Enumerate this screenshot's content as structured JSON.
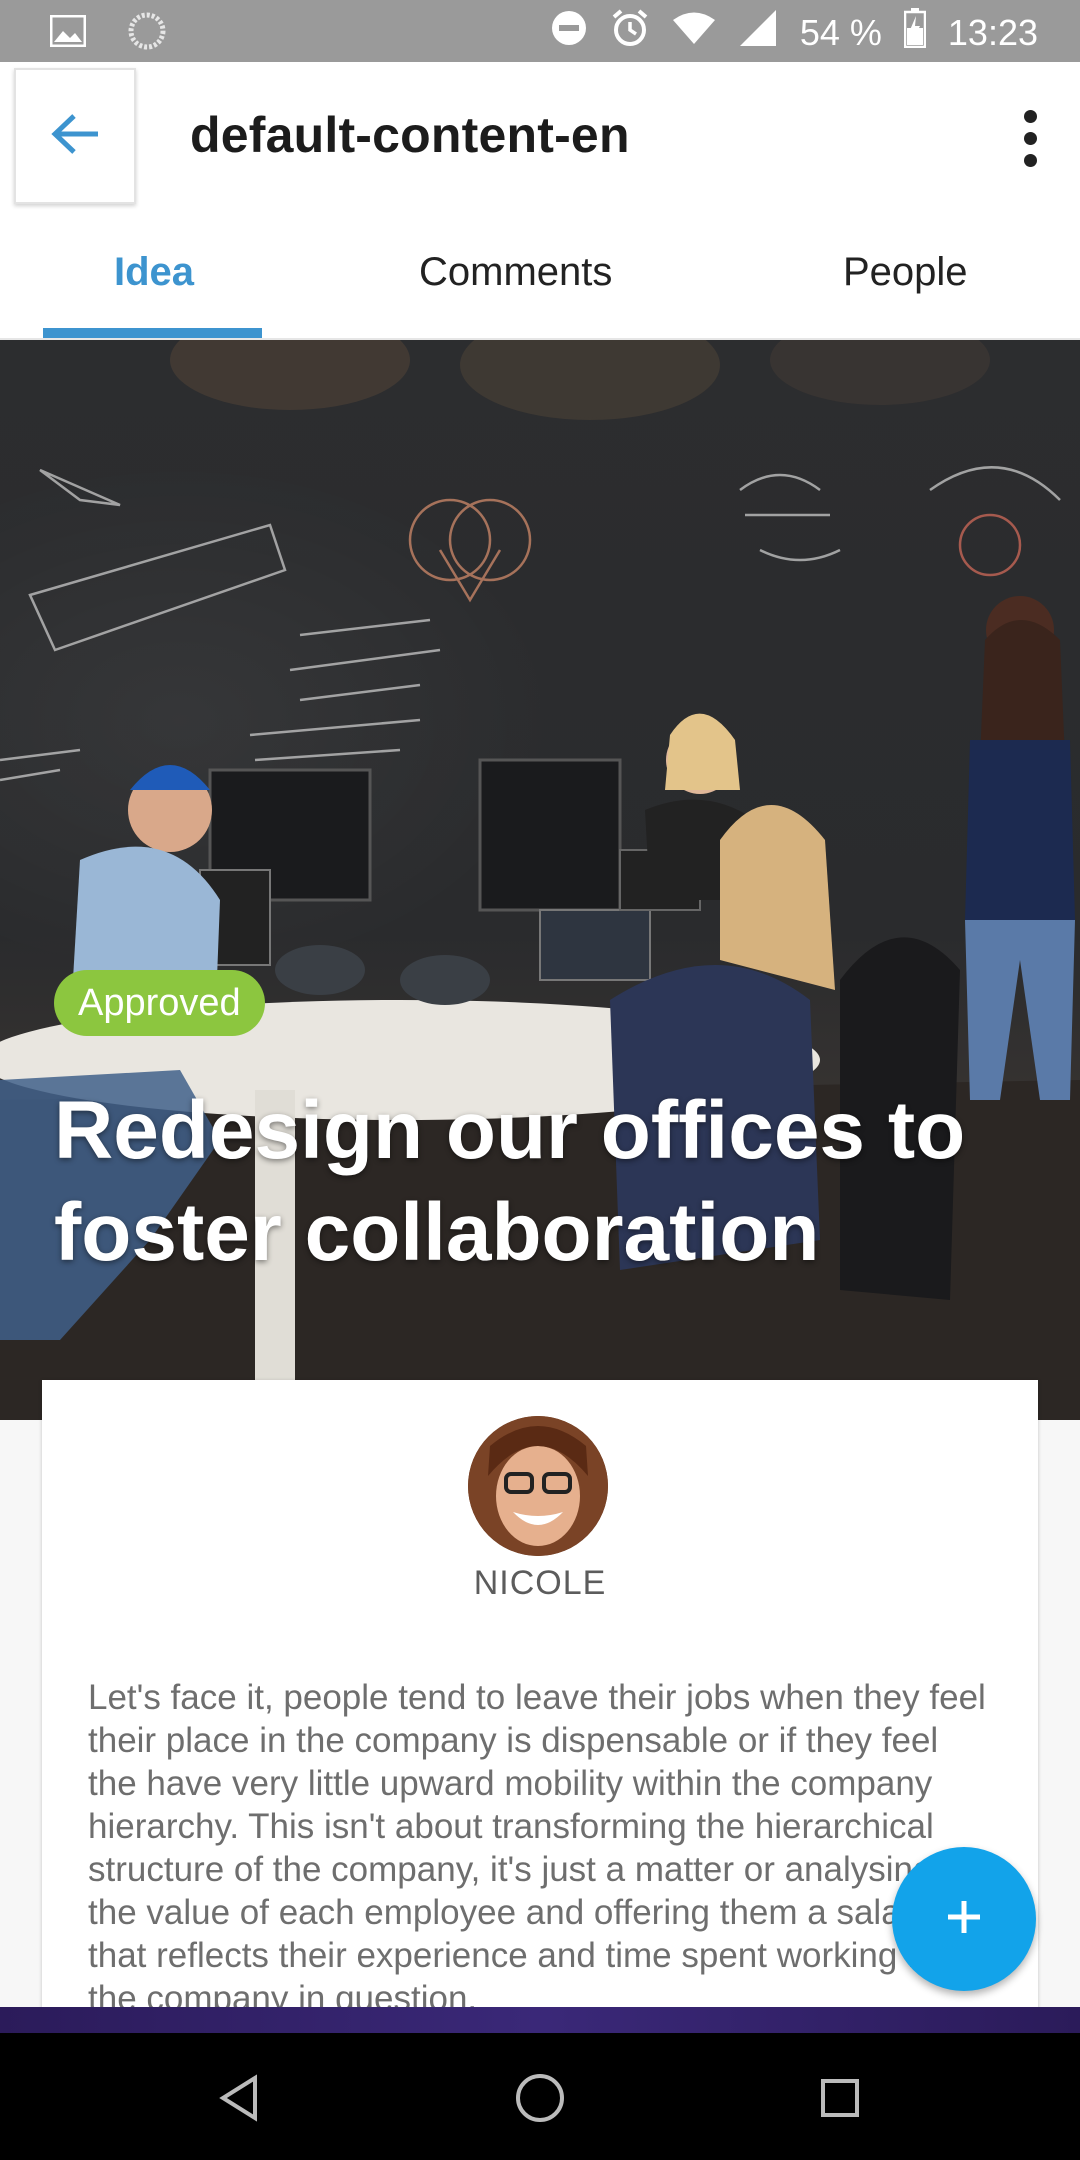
{
  "status_bar": {
    "battery": "54 %",
    "time": "13:23",
    "icons": [
      "image-icon",
      "sync-icon",
      "do-not-disturb-icon",
      "alarm-icon",
      "wifi-icon",
      "signal-icon",
      "battery-icon"
    ]
  },
  "app_bar": {
    "title": "default-content-en",
    "back_icon": "arrow-left-icon",
    "menu_icon": "more-vert-icon"
  },
  "tabs": [
    {
      "label": "Idea",
      "active": true
    },
    {
      "label": "Comments",
      "active": false
    },
    {
      "label": "People",
      "active": false
    }
  ],
  "idea": {
    "status_badge": "Approved",
    "title": "Redesign our offices to foster collaboration",
    "author": "NICOLE",
    "body": "Let's face it, people tend to leave their jobs when they feel their place in the company is dispensable or if they feel the have very little upward mobility within the company hierarchy. This isn't about transforming the hierarchical structure of the company, it's just a matter or analysing the value of each employee and offering them a salary that reflects their experience and time spent working for the company in question."
  },
  "fab": {
    "icon": "plus-icon"
  },
  "nav_bar": {
    "icons": [
      "back-triangle-icon",
      "home-circle-icon",
      "recents-square-icon"
    ]
  },
  "colors": {
    "accent": "#3d94cf",
    "badge": "#8cc63f",
    "fab": "#12a3ea",
    "status_bar": "#9a9a9a"
  }
}
